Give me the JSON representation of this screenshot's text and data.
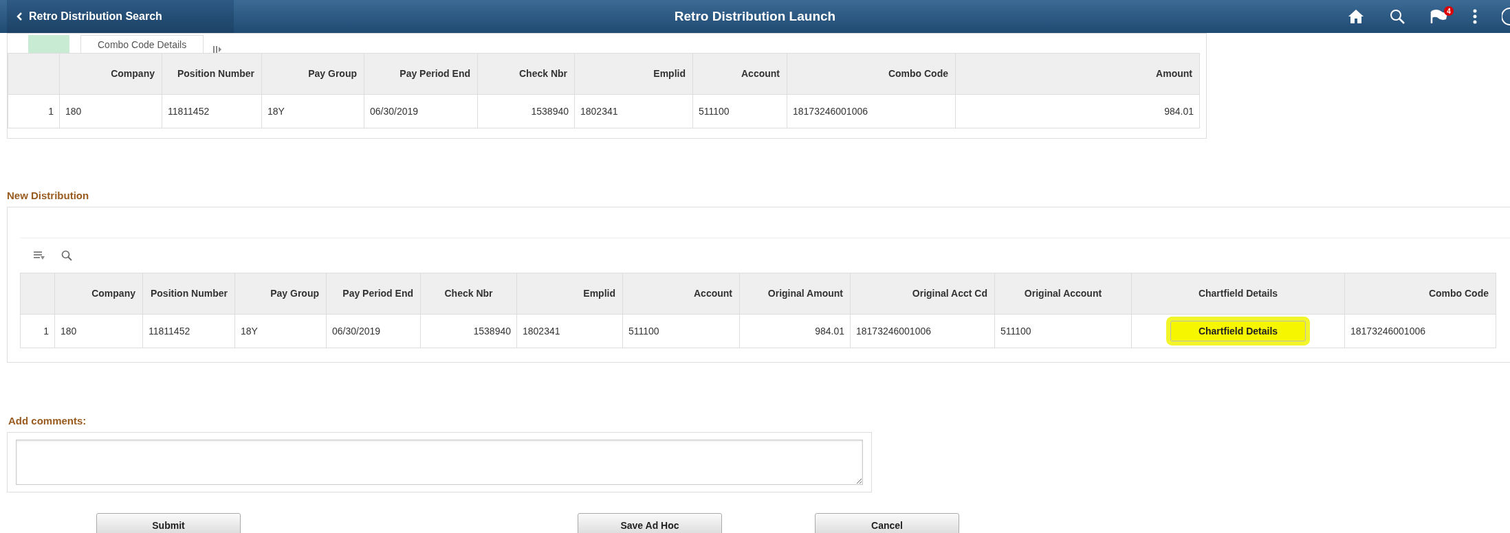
{
  "header": {
    "back_label": "Retro Distribution Search",
    "title": "Retro Distribution Launch",
    "notification_count": "4"
  },
  "current_grid": {
    "tabs": [
      {
        "label": "Combo Code Details",
        "selected": true
      }
    ],
    "columns": [
      "Company",
      "Position Number",
      "Pay Group",
      "Pay Period End",
      "Check Nbr",
      "Emplid",
      "Account",
      "Combo Code",
      "Amount"
    ],
    "rows": [
      {
        "row_number": "1",
        "cells": [
          "180",
          "11811452",
          "18Y",
          "06/30/2019",
          "1538940",
          "1802341",
          "511100",
          "18173246001006",
          "984.01"
        ]
      }
    ]
  },
  "new_distribution": {
    "title": "New Distribution",
    "columns": [
      "Company",
      "Position Number",
      "Pay Group",
      "Pay Period End",
      "Check Nbr",
      "Emplid",
      "Account",
      "Original Amount",
      "Original Acct Cd",
      "Original Account",
      "Chartfield Details",
      "Combo Code"
    ],
    "rows": [
      {
        "row_number": "1",
        "cells": [
          {
            "kind": "text",
            "value": "180"
          },
          {
            "kind": "text",
            "value": "11811452"
          },
          {
            "kind": "text",
            "value": "18Y"
          },
          {
            "kind": "text",
            "value": "06/30/2019"
          },
          {
            "kind": "number",
            "value": "1538940"
          },
          {
            "kind": "text",
            "value": "1802341"
          },
          {
            "kind": "text",
            "value": "511100"
          },
          {
            "kind": "number",
            "value": "984.01"
          },
          {
            "kind": "text",
            "value": "18173246001006"
          },
          {
            "kind": "text",
            "value": "511100"
          },
          {
            "kind": "button",
            "value": "Chartfield Details",
            "highlighted": true
          },
          {
            "kind": "text",
            "value": "18173246001006"
          }
        ]
      }
    ]
  },
  "comments": {
    "label": "Add comments:"
  },
  "buttons": [
    "Submit",
    "Save Ad Hoc",
    "Cancel"
  ]
}
